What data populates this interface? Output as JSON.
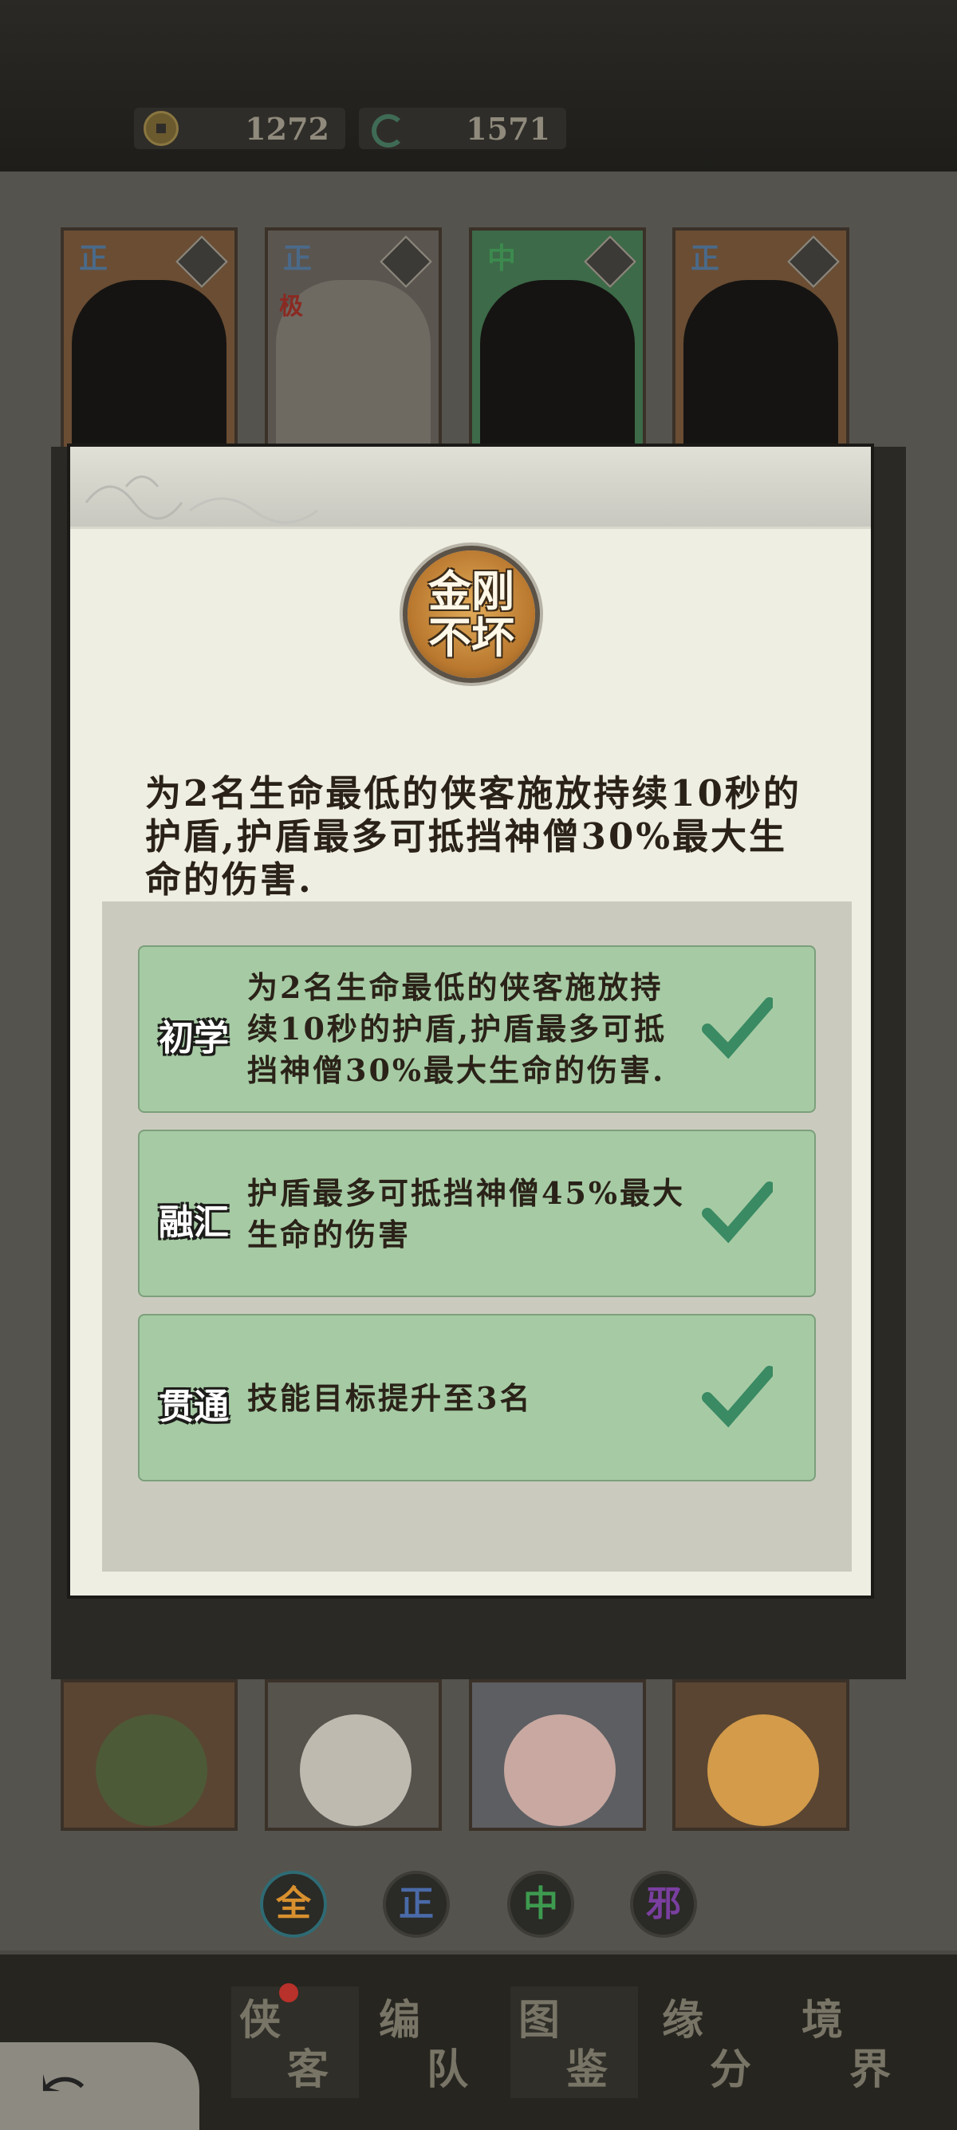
{
  "resources": {
    "coins": "1272",
    "jade": "1571"
  },
  "roster_top": [
    {
      "faction": "正",
      "tag_color": "#4a6a9a"
    },
    {
      "faction": "正",
      "tag_color": "#4a6a9a",
      "rank": "极"
    },
    {
      "faction": "中",
      "tag_color": "#3d8a4f"
    },
    {
      "faction": "正",
      "tag_color": "#4a6a9a"
    }
  ],
  "skill": {
    "icon_text_line1": "金刚",
    "icon_text_line2": "不坏",
    "description": "为2名生命最低的侠客施放持续10秒的护盾,护盾最多可抵挡神僧30%最大生命的伤害.",
    "levels": [
      {
        "name": "初学",
        "text": "为2名生命最低的侠客施放持续10秒的护盾,护盾最多可抵挡神僧30%最大生命的伤害.",
        "unlocked": true
      },
      {
        "name": "融汇",
        "text": "护盾最多可抵挡神僧45%最大生命的伤害",
        "unlocked": true
      },
      {
        "name": "贯通",
        "text": "技能目标提升至3名",
        "unlocked": true
      }
    ]
  },
  "filters": [
    {
      "label": "全",
      "color": "#d8902e"
    },
    {
      "label": "正",
      "color": "#4a6aa8"
    },
    {
      "label": "中",
      "color": "#3d9a4f"
    },
    {
      "label": "邪",
      "color": "#7a3fa0"
    }
  ],
  "nav": [
    {
      "a": "侠",
      "b": "客",
      "badge": true
    },
    {
      "a": "编",
      "b": "队"
    },
    {
      "a": "图",
      "b": "鉴"
    },
    {
      "a": "缘",
      "b": "分"
    },
    {
      "a": "境",
      "b": "界"
    }
  ],
  "colors": {
    "check": "#3a8a63",
    "panel": "#efeee3",
    "level_bg": "#a6cba4"
  }
}
